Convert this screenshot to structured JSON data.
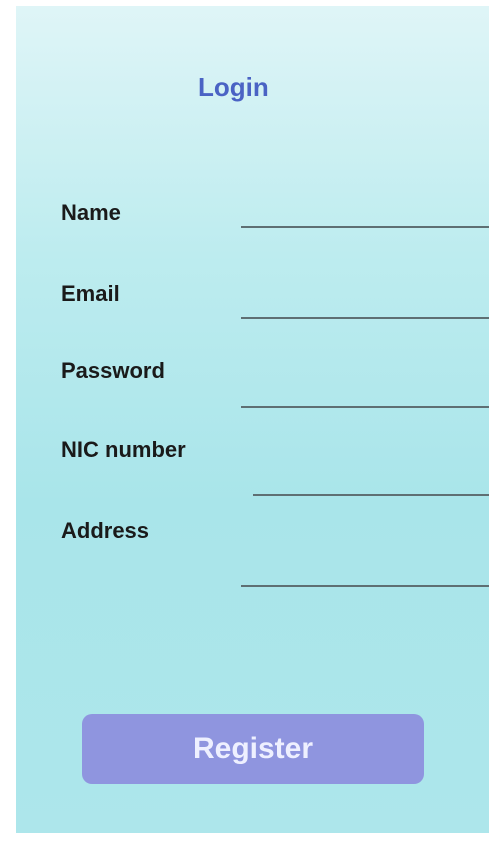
{
  "form": {
    "title": "Login",
    "fields": [
      {
        "label": "Name",
        "value": ""
      },
      {
        "label": "Email",
        "value": ""
      },
      {
        "label": "Password",
        "value": ""
      },
      {
        "label": "NIC number",
        "value": ""
      },
      {
        "label": "Address",
        "value": ""
      }
    ],
    "submit_label": "Register"
  },
  "colors": {
    "title": "#4a63c4",
    "button": "#8f95df",
    "button_text": "#eef0ff",
    "background_top": "#dff5f7",
    "background_bottom": "#ade6eb"
  }
}
